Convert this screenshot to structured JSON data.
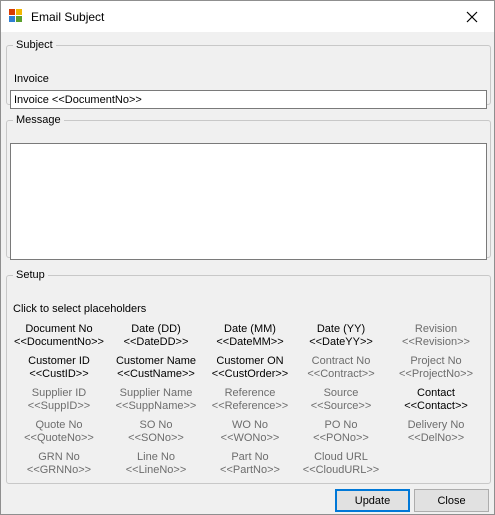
{
  "window": {
    "title": "Email Subject"
  },
  "subject": {
    "legend": "Subject",
    "label": "Invoice",
    "value": "Invoice <<DocumentNo>>"
  },
  "message": {
    "legend": "Message",
    "value": ""
  },
  "setup": {
    "legend": "Setup",
    "hint": "Click to select placeholders",
    "placeholders": [
      {
        "name": "Document No",
        "token": "<<DocumentNo>>",
        "enabled": true
      },
      {
        "name": "Date (DD)",
        "token": "<<DateDD>>",
        "enabled": true
      },
      {
        "name": "Date (MM)",
        "token": "<<DateMM>>",
        "enabled": true
      },
      {
        "name": "Date (YY)",
        "token": "<<DateYY>>",
        "enabled": true
      },
      {
        "name": "Revision",
        "token": "<<Revision>>",
        "enabled": false
      },
      {
        "name": "Customer ID",
        "token": "<<CustID>>",
        "enabled": true
      },
      {
        "name": "Customer Name",
        "token": "<<CustName>>",
        "enabled": true
      },
      {
        "name": "Customer ON",
        "token": "<<CustOrder>>",
        "enabled": true
      },
      {
        "name": "Contract No",
        "token": "<<Contract>>",
        "enabled": false
      },
      {
        "name": "Project No",
        "token": "<<ProjectNo>>",
        "enabled": false
      },
      {
        "name": "Supplier ID",
        "token": "<<SuppID>>",
        "enabled": false
      },
      {
        "name": "Supplier Name",
        "token": "<<SuppName>>",
        "enabled": false
      },
      {
        "name": "Reference",
        "token": "<<Reference>>",
        "enabled": false
      },
      {
        "name": "Source",
        "token": "<<Source>>",
        "enabled": false
      },
      {
        "name": "Contact",
        "token": "<<Contact>>",
        "enabled": true
      },
      {
        "name": "Quote No",
        "token": "<<QuoteNo>>",
        "enabled": false
      },
      {
        "name": "SO No",
        "token": "<<SONo>>",
        "enabled": false
      },
      {
        "name": "WO No",
        "token": "<<WONo>>",
        "enabled": false
      },
      {
        "name": "PO No",
        "token": "<<PONo>>",
        "enabled": false
      },
      {
        "name": "Delivery No",
        "token": "<<DelNo>>",
        "enabled": false
      },
      {
        "name": "GRN No",
        "token": "<<GRNNo>>",
        "enabled": false
      },
      {
        "name": "Line No",
        "token": "<<LineNo>>",
        "enabled": false
      },
      {
        "name": "Part No",
        "token": "<<PartNo>>",
        "enabled": false
      },
      {
        "name": "Cloud URL",
        "token": "<<CloudURL>>",
        "enabled": false
      }
    ]
  },
  "buttons": {
    "update": "Update",
    "close": "Close"
  },
  "icons": {
    "app": "app-icon",
    "close": "close-icon"
  },
  "colors": {
    "enabled_text": "#000000",
    "disabled_text": "#6d6d6d",
    "focus_border": "#0078d7"
  }
}
